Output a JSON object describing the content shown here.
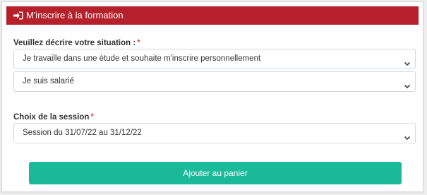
{
  "header": {
    "title": "M'inscrire à la formation",
    "icon": "sign-in-icon"
  },
  "situation": {
    "label": "Veuillez décrire votre situation :",
    "required_mark": "*",
    "select1_value": "Je travaille dans une étude et souhaite m'inscrire personnellement",
    "select2_value": "Je suis salarié"
  },
  "session": {
    "label": "Choix de la session",
    "required_mark": "*",
    "select_value": "Session du 31/07/22 au 31/12/22"
  },
  "actions": {
    "add_to_cart_label": "Ajouter au panier"
  },
  "colors": {
    "header_bg": "#b5202a",
    "button_bg": "#1ab99a",
    "required": "#d9534f"
  }
}
